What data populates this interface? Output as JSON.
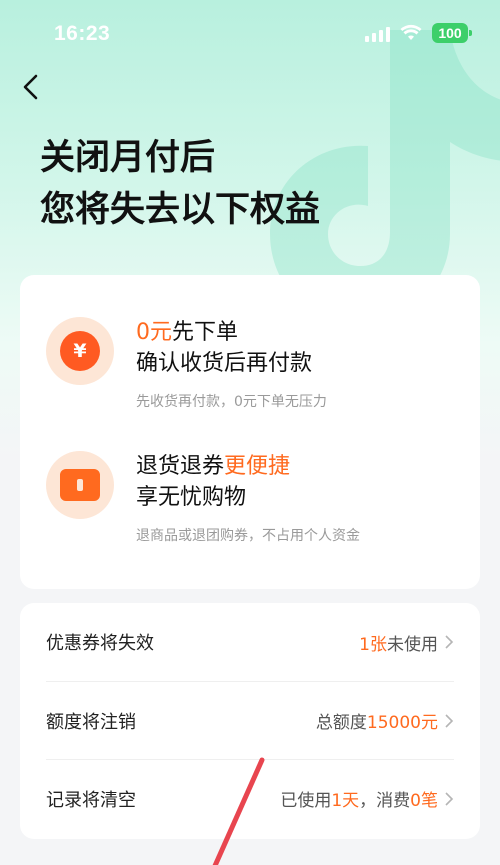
{
  "status_bar": {
    "time": "16:23",
    "battery": "100"
  },
  "headline": {
    "line1": "关闭月付后",
    "line2": "您将失去以下权益"
  },
  "benefits": [
    {
      "icon": "yuan-icon",
      "icon_glyph": "¥",
      "title_highlight": "0元",
      "title_rest": "先下单",
      "title_line2": "确认收货后再付款",
      "desc": "先收货再付款，0元下单无压力"
    },
    {
      "icon": "ticket-icon",
      "title_pre": "退货退券",
      "title_highlight": "更便捷",
      "title_line2": "享无忧购物",
      "desc": "退商品或退团购券，不占用个人资金"
    }
  ],
  "rows": [
    {
      "label": "优惠券将失效",
      "hl": "1张",
      "rest": "未使用"
    },
    {
      "label": "额度将注销",
      "pre": "总额度",
      "hl": "15000元"
    },
    {
      "label": "记录将清空",
      "pre": "已使用",
      "hl": "1天",
      "mid": "，消费",
      "hl2": "0笔"
    }
  ],
  "colors": {
    "accent": "#ff6a1f",
    "hero": "#b8f0de",
    "battery": "#3ccf6a"
  }
}
